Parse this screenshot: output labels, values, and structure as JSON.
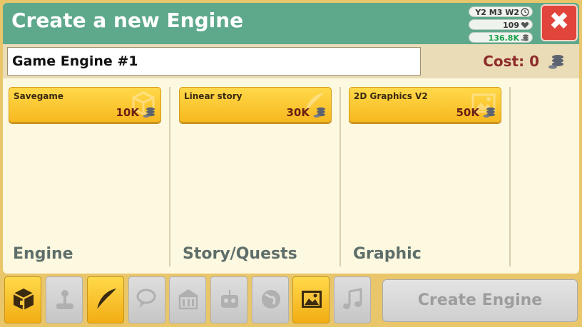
{
  "dialog": {
    "title": "Create a new Engine",
    "close_label": "✖"
  },
  "stats": {
    "date": "Y2 M3 W2",
    "fans": "109",
    "money": "136.8K"
  },
  "engine": {
    "name": "Game Engine #1",
    "cost_label": "Cost: 0"
  },
  "columns": [
    {
      "label": "Engine",
      "card": {
        "name": "Savegame",
        "cost": "10K"
      }
    },
    {
      "label": "Story/Quests",
      "card": {
        "name": "Linear story",
        "cost": "30K"
      }
    },
    {
      "label": "Graphic",
      "card": {
        "name": "2D Graphics V2",
        "cost": "50K"
      }
    }
  ],
  "tabs": [
    {
      "icon": "engine-cube-icon",
      "active": true
    },
    {
      "icon": "joystick-icon",
      "active": false
    },
    {
      "icon": "feather-quill-icon",
      "active": true
    },
    {
      "icon": "speech-bubble-icon",
      "active": false
    },
    {
      "icon": "building-icon",
      "active": false
    },
    {
      "icon": "robot-icon",
      "active": false
    },
    {
      "icon": "globe-icon",
      "active": false
    },
    {
      "icon": "picture-icon",
      "active": true
    },
    {
      "icon": "music-note-icon",
      "active": false
    }
  ],
  "actions": {
    "create_label": "Create Engine"
  },
  "colors": {
    "header": "#5ea98c",
    "card": "#ffd94a",
    "cost_text": "#8e2c2c",
    "close": "#e0443a"
  }
}
